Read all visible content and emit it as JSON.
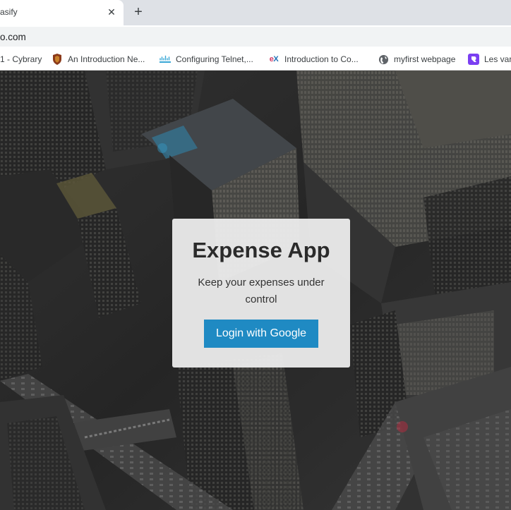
{
  "browser": {
    "tab": {
      "title": "asify",
      "close_glyph": "✕"
    },
    "new_tab_glyph": "+",
    "address": "o.com",
    "bookmarks": [
      {
        "label": "1 - Cybrary",
        "icon": "none"
      },
      {
        "label": "An Introduction Ne...",
        "icon": "shield-crest-icon"
      },
      {
        "label": "Configuring Telnet,...",
        "icon": "cisco-icon"
      },
      {
        "label": "Introduction to Co...",
        "icon": "edx-icon"
      },
      {
        "label": "myfirst webpage",
        "icon": "globe-icon"
      },
      {
        "label": "Les vari",
        "icon": "purple-logo-icon"
      }
    ]
  },
  "app": {
    "title": "Expense App",
    "subtitle": "Keep your expenses under control",
    "login_button": "Login with Google",
    "button_color": "#1f8ac3"
  }
}
